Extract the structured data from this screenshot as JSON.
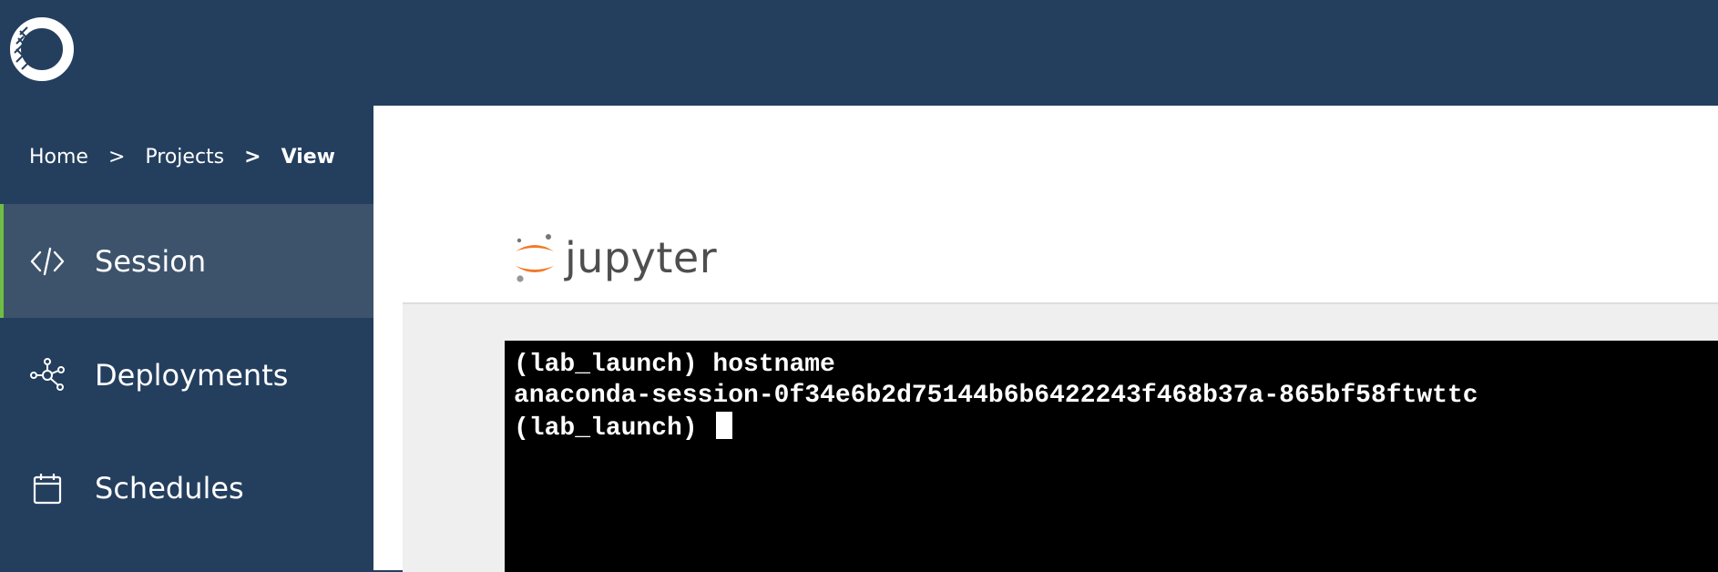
{
  "breadcrumb": {
    "home": "Home",
    "projects": "Projects",
    "current": "View",
    "separator": ">"
  },
  "sidebar": {
    "items": [
      {
        "label": "Session",
        "icon": "code-icon",
        "active": true
      },
      {
        "label": "Deployments",
        "icon": "network-icon",
        "active": false
      },
      {
        "label": "Schedules",
        "icon": "calendar-icon",
        "active": false
      }
    ]
  },
  "jupyter": {
    "wordmark": "jupyter"
  },
  "terminal": {
    "lines": [
      "(lab_launch) hostname",
      "anaconda-session-0f34e6b2d75144b6b6422243f468b37a-865bf58ftwttc",
      "(lab_launch) "
    ]
  },
  "colors": {
    "header_bg": "#243f5e",
    "active_item_bg": "#3d536c",
    "active_accent": "#6fbe44",
    "jupyter_orange": "#f37726",
    "terminal_bg": "#000000"
  }
}
